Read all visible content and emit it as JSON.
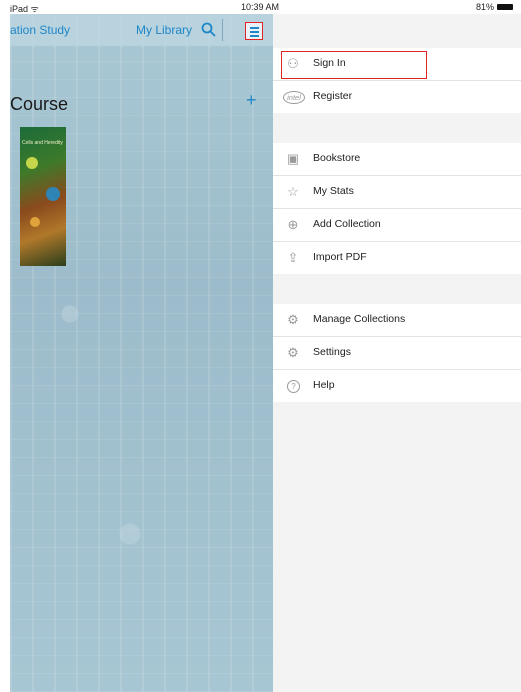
{
  "status_bar": {
    "device": "iPad ᯤ",
    "time": "10:39 AM",
    "battery": "81%"
  },
  "library": {
    "title": "ation Study",
    "my_library": "My Library",
    "course_heading": "Course",
    "add_label": "+",
    "book_caption": "Cells and Heredity"
  },
  "menu": {
    "account": [
      {
        "icon": "person-icon",
        "glyph": "⚇",
        "label": "Sign In"
      },
      {
        "icon": "intel-logo-icon",
        "glyph": "intel",
        "label": "Register"
      }
    ],
    "content": [
      {
        "icon": "bookstore-icon",
        "glyph": "▣",
        "label": "Bookstore"
      },
      {
        "icon": "star-icon",
        "glyph": "☆",
        "label": "My Stats"
      },
      {
        "icon": "add-circle-icon",
        "glyph": "⊕",
        "label": "Add Collection"
      },
      {
        "icon": "import-pdf-icon",
        "glyph": "⇪",
        "label": "Import PDF"
      }
    ],
    "system": [
      {
        "icon": "manage-gear-icon",
        "glyph": "⚙",
        "label": "Manage Collections"
      },
      {
        "icon": "settings-gear-icon",
        "glyph": "⚙",
        "label": "Settings"
      },
      {
        "icon": "help-icon",
        "glyph": "?",
        "label": "Help"
      }
    ]
  },
  "colors": {
    "accent": "#1f86c8",
    "highlight": "#e02424"
  }
}
